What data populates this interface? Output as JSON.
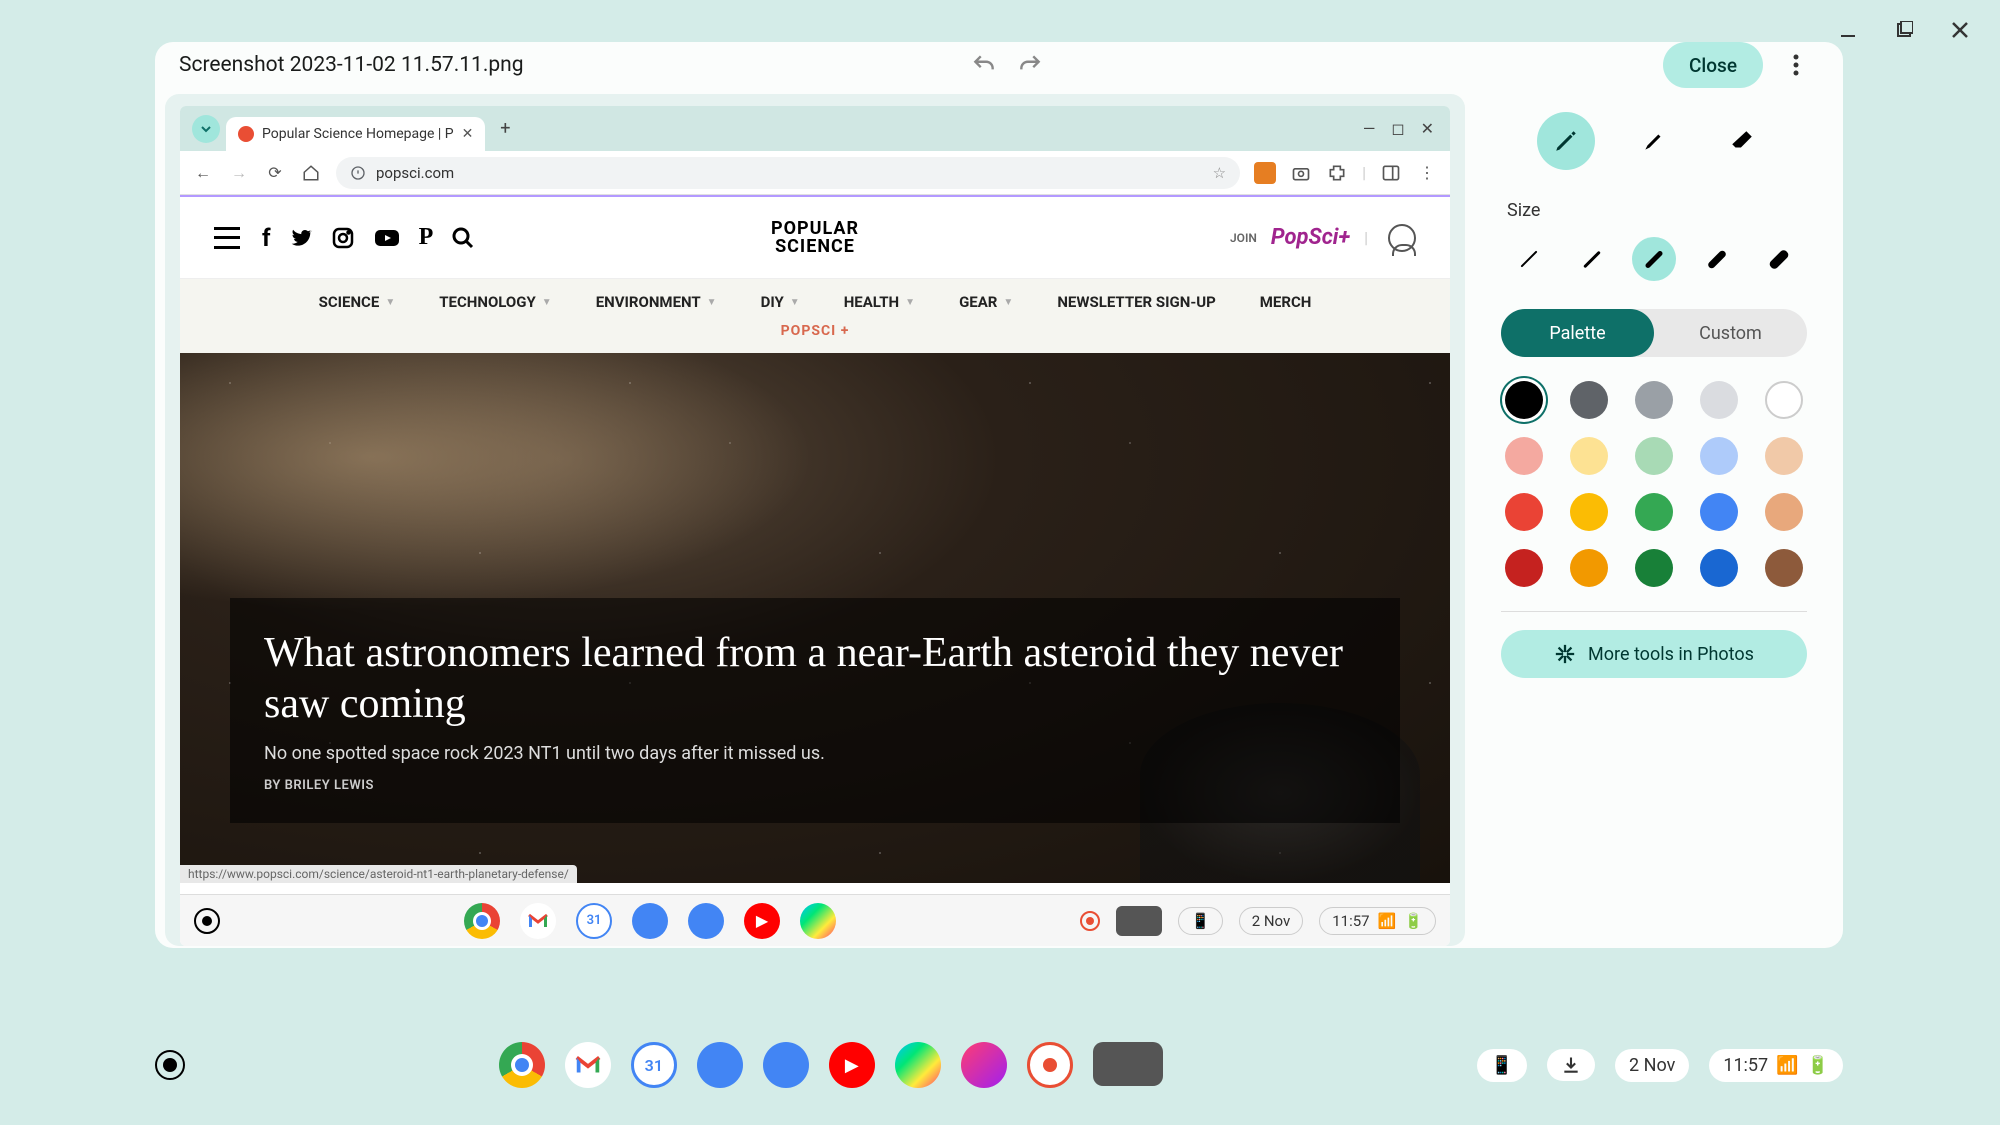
{
  "window_controls": {
    "minimize": "minimize",
    "maximize": "maximize",
    "close": "close"
  },
  "editor": {
    "filename": "Screenshot 2023-11-02 11.57.11.png",
    "close_label": "Close"
  },
  "panel": {
    "tools": [
      "pen",
      "highlighter",
      "eraser"
    ],
    "size_label": "Size",
    "sizes": [
      1,
      2,
      3,
      4,
      5
    ],
    "selected_size_index": 2,
    "color_tabs": {
      "palette": "Palette",
      "custom": "Custom"
    },
    "palette": [
      "#000000",
      "#5f6368",
      "#9aa0a6",
      "#dadce0",
      "#ffffff",
      "#f4a9a0",
      "#fde293",
      "#a8dab5",
      "#aecbfa",
      "#f1c9a8",
      "#ea4335",
      "#fbbc04",
      "#34a853",
      "#4285f4",
      "#e8a87c",
      "#c5221f",
      "#f29900",
      "#188038",
      "#1967d2",
      "#8d5a3b"
    ],
    "selected_color_index": 0,
    "more_tools_label": "More tools in Photos"
  },
  "screenshot": {
    "browser": {
      "tab_title": "Popular Science Homepage | P",
      "url_display": "popsci.com",
      "status_url": "https://www.popsci.com/science/asteroid-nt1-earth-planetary-defense/"
    },
    "site": {
      "logo_line1": "POPULAR",
      "logo_line2": "SCIENCE",
      "join_label": "JOIN",
      "plus_brand": "PopSci+",
      "nav": [
        "SCIENCE",
        "TECHNOLOGY",
        "ENVIRONMENT",
        "DIY",
        "HEALTH",
        "GEAR",
        "NEWSLETTER SIGN-UP",
        "MERCH"
      ],
      "nav_sub": "POPSCI +",
      "hero_title": "What astronomers learned from a near-Earth asteroid they never saw coming",
      "hero_sub": "No one spotted space rock 2023 NT1 until two days after it missed us.",
      "hero_byline": "BY BRILEY LEWIS"
    },
    "inner_shelf": {
      "date": "2 Nov",
      "time": "11:57"
    }
  },
  "outer_shelf": {
    "date": "2 Nov",
    "time": "11:57"
  }
}
